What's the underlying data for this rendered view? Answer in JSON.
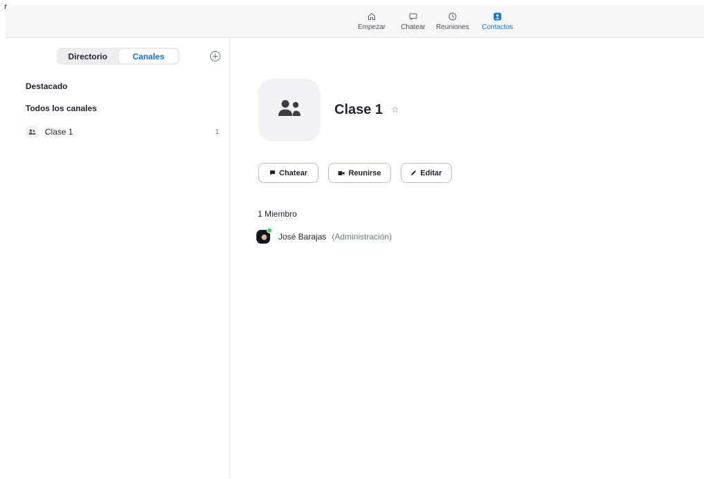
{
  "nav": {
    "items": [
      {
        "label": "Empezar",
        "icon": "home-icon"
      },
      {
        "label": "Chatear",
        "icon": "chat-bubble-icon"
      },
      {
        "label": "Reuniones",
        "icon": "clock-icon"
      },
      {
        "label": "Contactos",
        "icon": "contacts-icon",
        "active": true
      }
    ]
  },
  "sidebar": {
    "segments": {
      "directory": "Directorio",
      "channels": "Canales",
      "selected": "Canales"
    },
    "sections": {
      "featured": "Destacado",
      "all_channels": "Todos los canales"
    },
    "channels": [
      {
        "name": "Clase 1",
        "count": "1"
      }
    ]
  },
  "channel": {
    "title": "Clase 1",
    "actions": {
      "chat": "Chatear",
      "meet": "Reunirse",
      "edit": "Editar"
    },
    "members_count": "1 Miembro",
    "members": [
      {
        "name": "José Barajas",
        "role": "(Administración)",
        "status": "online"
      }
    ]
  },
  "colors": {
    "accent": "#0e72ed",
    "text": "#232333",
    "muted": "#6e7680",
    "online": "#3ccf5a",
    "tile_bg": "#f2f2f5"
  }
}
